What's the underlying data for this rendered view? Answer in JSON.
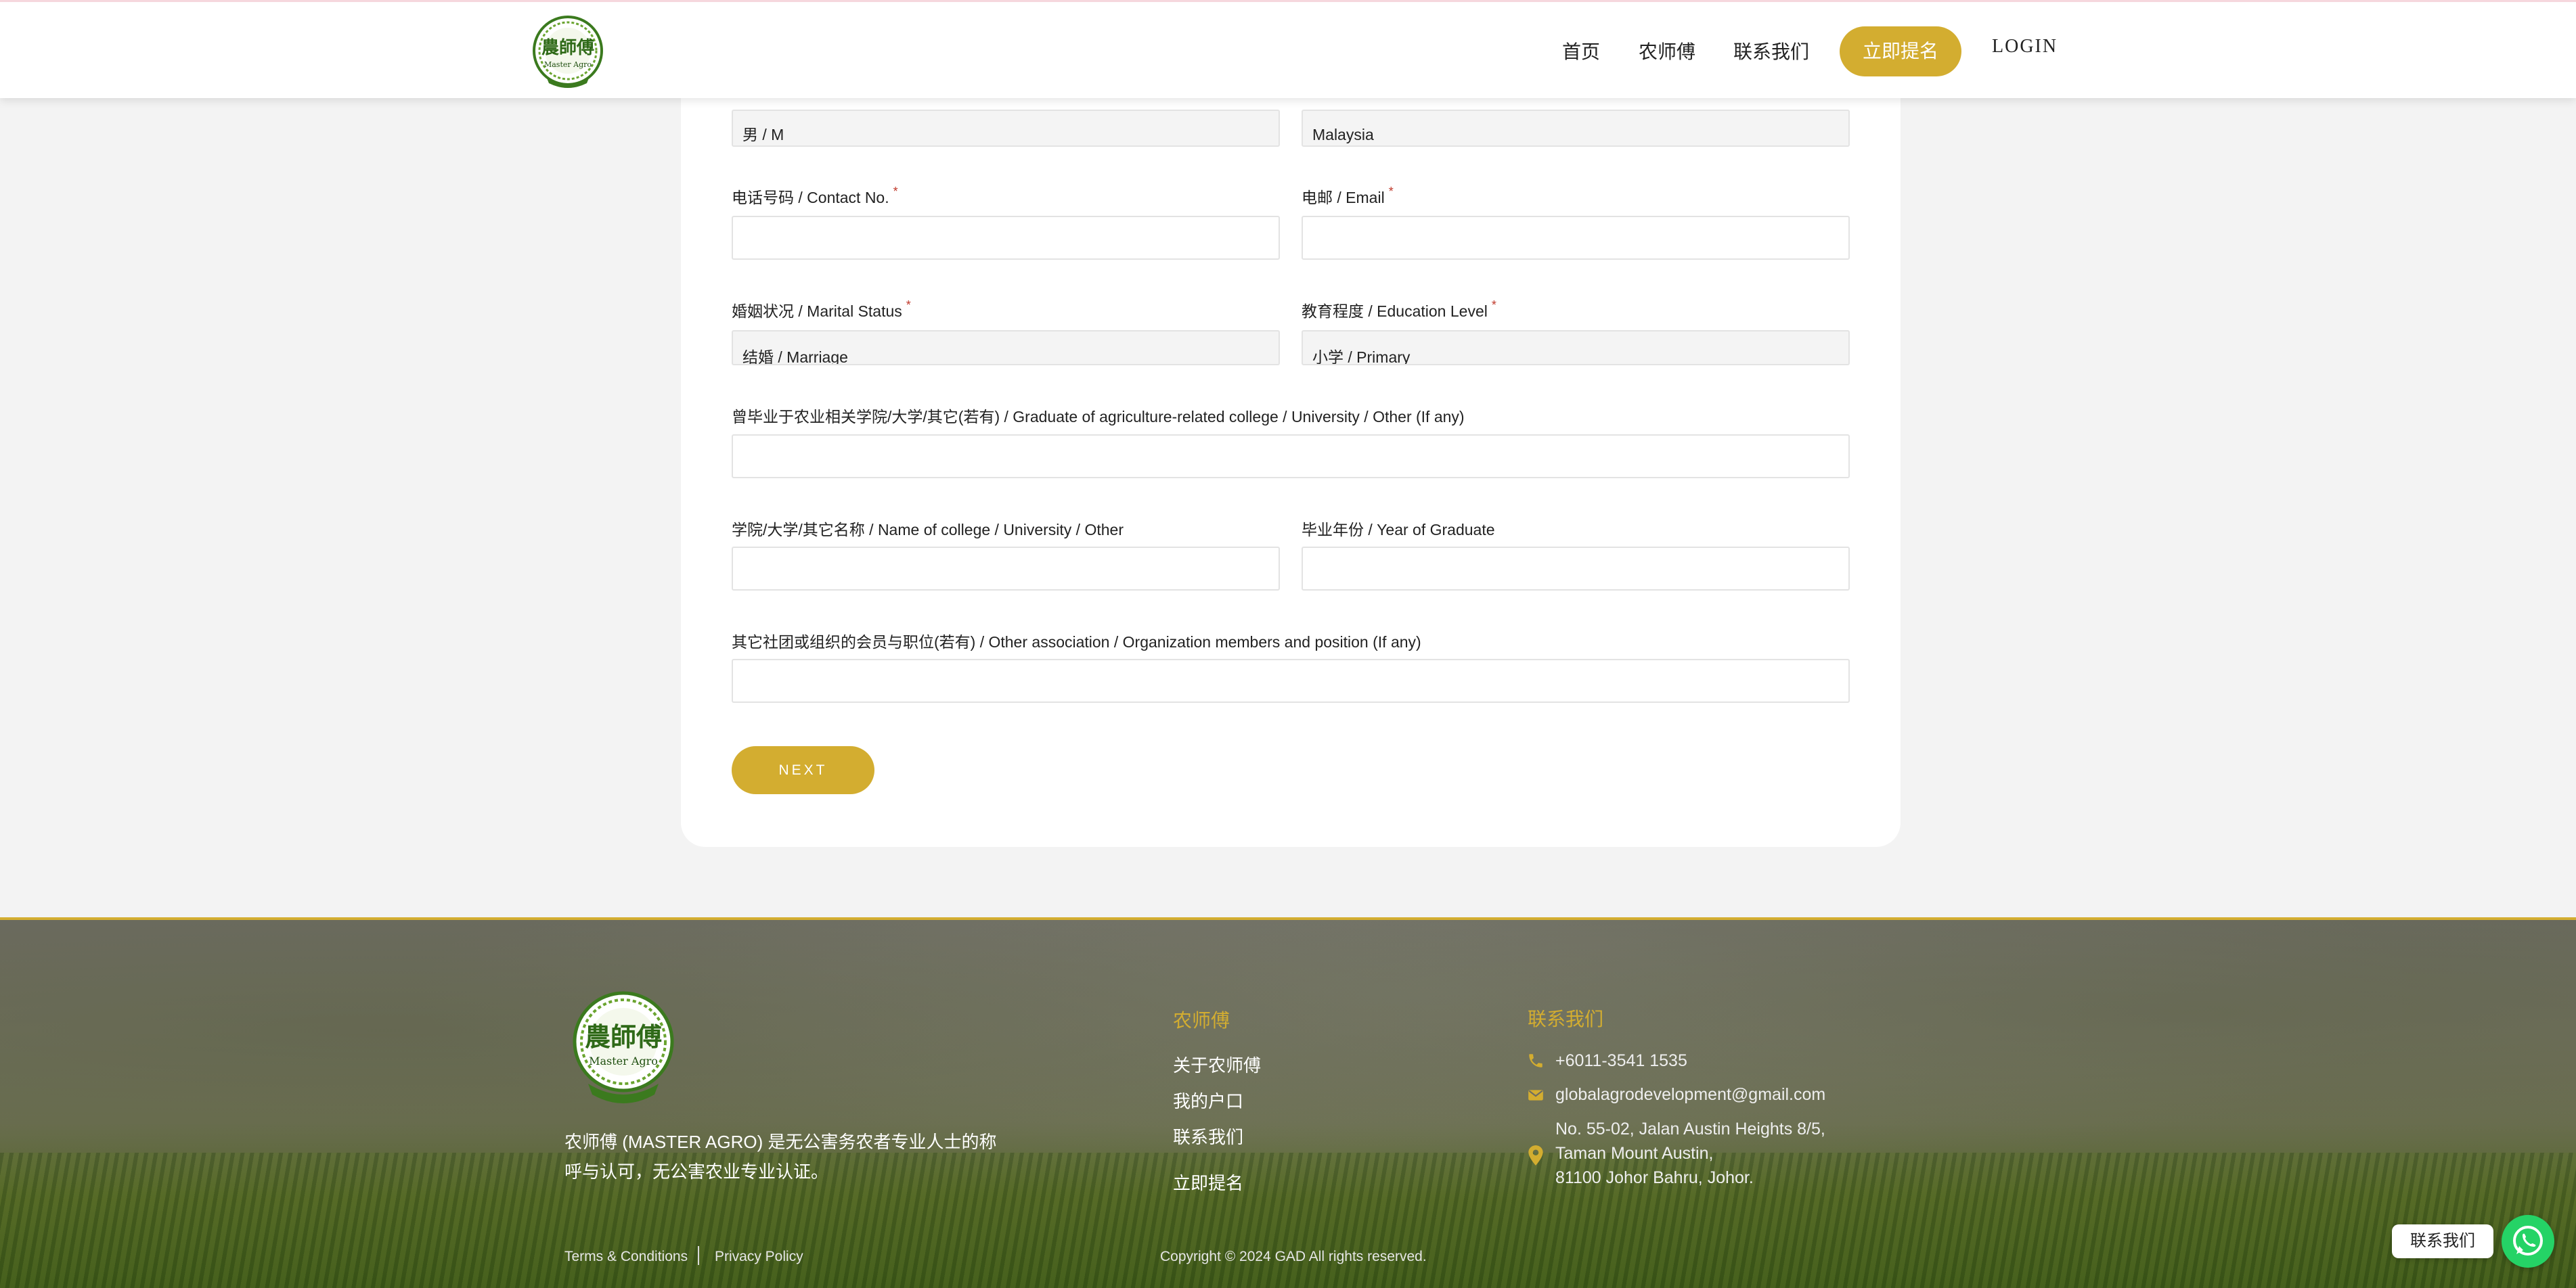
{
  "header": {
    "nav": [
      "首页",
      "农师傅",
      "联系我们"
    ],
    "cta_label": "立即提名",
    "login_label": "LOGIN"
  },
  "form": {
    "gender_value": "男 / M",
    "country_value": "Malaysia",
    "contact_label": "电话号码 / Contact No.",
    "email_label": "电邮 / Email",
    "marital_label": "婚姻状况 / Marital Status",
    "marital_value": "结婚 / Marriage",
    "education_label": "教育程度 / Education Level",
    "education_value": "小学 / Primary",
    "graduate_label": "曾毕业于农业相关学院/大学/其它(若有) / Graduate of agriculture-related college / University / Other (If any)",
    "college_label": "学院/大学/其它名称 / Name of college / University / Other",
    "year_label": "毕业年份 / Year of Graduate",
    "association_label": "其它社团或组织的会员与职位(若有) / Other association / Organization members and position (If any)",
    "required_mark": "*",
    "next_label": "NEXT"
  },
  "footer": {
    "description": "农师傅 (MASTER AGRO) 是无公害务农者专业人士的称呼与认可，无公害农业专业认证。",
    "col1_title": "农师傅",
    "col1_links": [
      "关于农师傅",
      "我的户口",
      "联系我们",
      "立即提名"
    ],
    "col2_title": "联系我们",
    "phone": "+6011-3541 1535",
    "email": "globalagrodevelopment@gmail.com",
    "address_lines": [
      "No. 55-02, Jalan Austin Heights 8/5,",
      "Taman Mount Austin,",
      "81100 Johor Bahru, Johor."
    ],
    "terms": "Terms & Conditions",
    "privacy": "Privacy Policy",
    "copyright": "Copyright © 2024 GAD All rights reserved."
  },
  "logo": {
    "title": "農師傅",
    "subtitle": "Master Agro"
  },
  "whatsapp": {
    "label": "联系我们"
  },
  "colors": {
    "accent": "#d3ad30",
    "whatsapp": "#25d366",
    "logo_green": "#3b7a1e"
  }
}
